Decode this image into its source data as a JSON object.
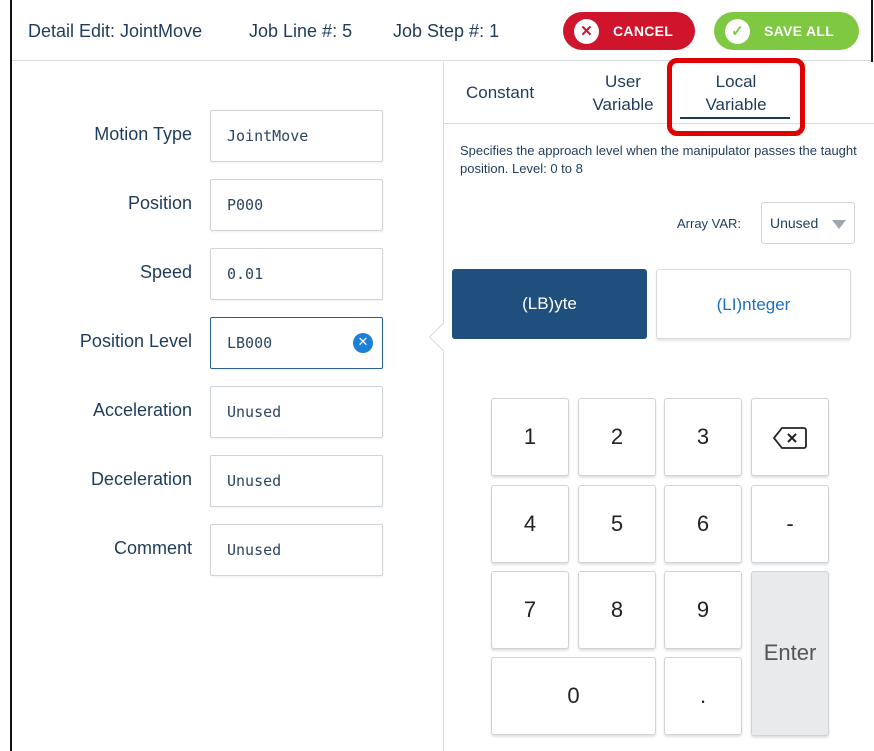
{
  "header": {
    "title": "Detail Edit: JointMove",
    "job_line": "Job Line #: 5",
    "job_step": "Job Step #: 1",
    "cancel_label": "CANCEL",
    "save_label": "SAVE ALL"
  },
  "fields": [
    {
      "label": "Motion Type",
      "value": "JointMove"
    },
    {
      "label": "Position",
      "value": "P000"
    },
    {
      "label": "Speed",
      "value": "0.01"
    },
    {
      "label": "Position Level",
      "value": "LB000"
    },
    {
      "label": "Acceleration",
      "value": "Unused"
    },
    {
      "label": "Deceleration",
      "value": "Unused"
    },
    {
      "label": "Comment",
      "value": "Unused"
    }
  ],
  "tabs": {
    "constant": "Constant",
    "user_line1": "User",
    "user_line2": "Variable",
    "local_line1": "Local",
    "local_line2": "Variable",
    "selected": "Local Variable"
  },
  "description": "Specifies the approach level when the manipulator passes the taught position. Level: 0 to 8",
  "array_var": {
    "label": "Array VAR:",
    "value": "Unused"
  },
  "type_buttons": {
    "byte": "(LB)yte",
    "integer": "(LI)nteger",
    "selected": "(LB)yte"
  },
  "keypad": {
    "k1": "1",
    "k2": "2",
    "k3": "3",
    "k4": "4",
    "k5": "5",
    "k6": "6",
    "k7": "7",
    "k8": "8",
    "k9": "9",
    "k0": "0",
    "dot": ".",
    "minus": "-",
    "enter": "Enter",
    "backspace_icon": "backspace-icon"
  },
  "colors": {
    "cancel": "#d0142b",
    "save": "#7ec842",
    "selected_type": "#1e4f7d",
    "highlight": "#e00000"
  }
}
